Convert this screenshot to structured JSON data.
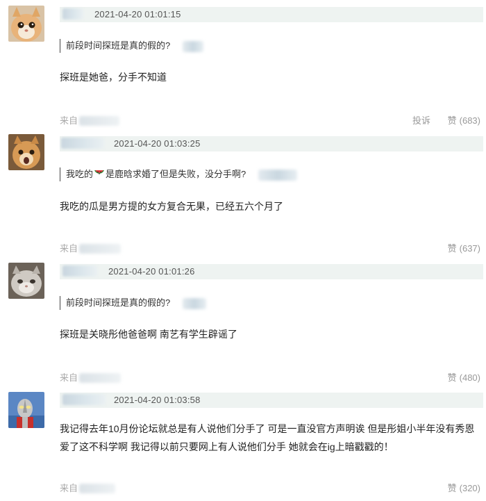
{
  "comments": [
    {
      "time": "2021-04-20 01:01:15",
      "quote": "前段时间探班是真的假的?",
      "body": "探班是她爸，分手不知道",
      "source_label": "来自",
      "report": "投诉",
      "like_label": "赞",
      "like_count": "(683)",
      "avatar": "orange-kitten-avatar"
    },
    {
      "time": "2021-04-20 01:03:25",
      "quote_before": "我吃的",
      "quote_after": "是鹿晗求婚了但是失败，没分手啊?",
      "quote_icon": "watermelon-icon",
      "body": "我吃的瓜是男方提的女方复合无果，已经五六个月了",
      "source_label": "来自",
      "like_label": "赞",
      "like_count": "(637)",
      "avatar": "surprised-cat-avatar"
    },
    {
      "time": "2021-04-20 01:01:26",
      "quote": "前段时间探班是真的假的?",
      "body": "探班是关晓彤他爸爸啊 南艺有学生辟谣了",
      "source_label": "来自",
      "like_label": "赞",
      "like_count": "(480)",
      "avatar": "grey-cat-avatar"
    },
    {
      "time": "2021-04-20 01:03:58",
      "body": "我记得去年10月份论坛就总是有人说他们分手了 可是一直没官方声明诶 但是彤姐小半年没有秀恩爱了这不科学啊 我记得以前只要网上有人说他们分手 她就会在ig上暗戳戳的！",
      "source_label": "来自",
      "like_label": "赞",
      "like_count": "(320)",
      "avatar": "ultraman-avatar"
    }
  ],
  "colors": {
    "header_bg": "#eef3f1",
    "muted_text": "#999999",
    "body_text": "#222222"
  }
}
